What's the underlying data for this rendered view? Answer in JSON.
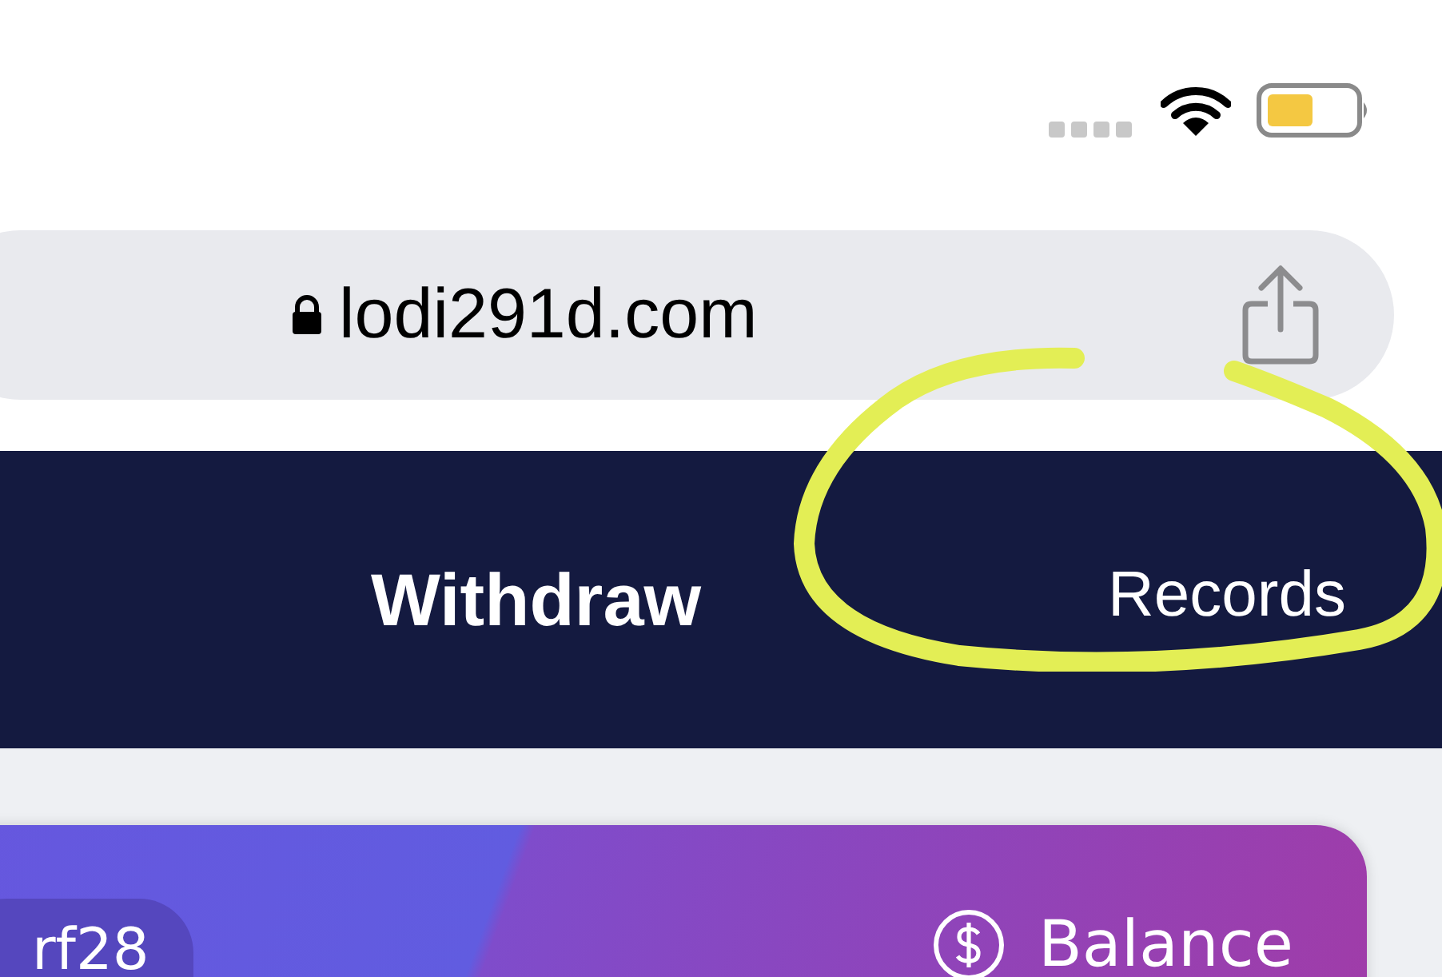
{
  "browser": {
    "url": "lodi291d.com",
    "secure": true
  },
  "header": {
    "title": "Withdraw",
    "action": "Records"
  },
  "card": {
    "user_tag": "rf28",
    "balance_label": "Balance"
  }
}
